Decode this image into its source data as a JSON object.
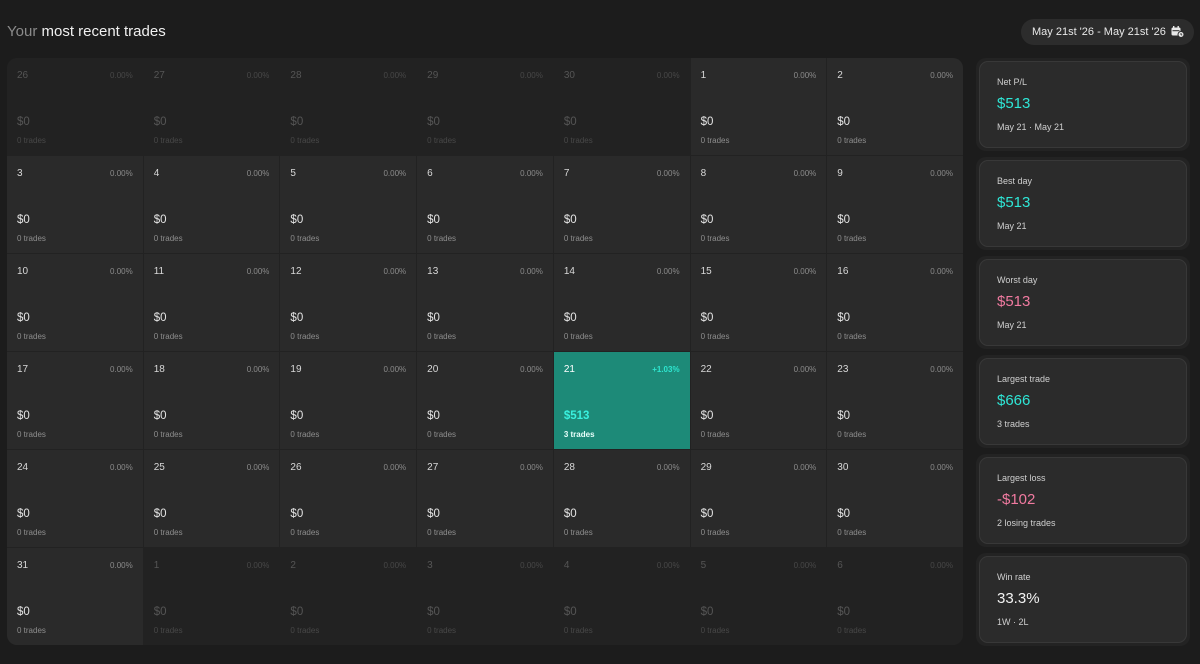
{
  "header": {
    "title_muted": "Your ",
    "title_strong": "most recent trades",
    "date_range": "May 21st '26 - May 21st '26",
    "date_icon": "calendar-icon"
  },
  "calendar": {
    "cells": [
      {
        "day": "26",
        "pct": "0.00%",
        "amount": "$0",
        "trades": "0 trades",
        "state": "out"
      },
      {
        "day": "27",
        "pct": "0.00%",
        "amount": "$0",
        "trades": "0 trades",
        "state": "out"
      },
      {
        "day": "28",
        "pct": "0.00%",
        "amount": "$0",
        "trades": "0 trades",
        "state": "out"
      },
      {
        "day": "29",
        "pct": "0.00%",
        "amount": "$0",
        "trades": "0 trades",
        "state": "out"
      },
      {
        "day": "30",
        "pct": "0.00%",
        "amount": "$0",
        "trades": "0 trades",
        "state": "out"
      },
      {
        "day": "1",
        "pct": "0.00%",
        "amount": "$0",
        "trades": "0 trades",
        "state": "in"
      },
      {
        "day": "2",
        "pct": "0.00%",
        "amount": "$0",
        "trades": "0 trades",
        "state": "in"
      },
      {
        "day": "3",
        "pct": "0.00%",
        "amount": "$0",
        "trades": "0 trades",
        "state": "in"
      },
      {
        "day": "4",
        "pct": "0.00%",
        "amount": "$0",
        "trades": "0 trades",
        "state": "in"
      },
      {
        "day": "5",
        "pct": "0.00%",
        "amount": "$0",
        "trades": "0 trades",
        "state": "in"
      },
      {
        "day": "6",
        "pct": "0.00%",
        "amount": "$0",
        "trades": "0 trades",
        "state": "in"
      },
      {
        "day": "7",
        "pct": "0.00%",
        "amount": "$0",
        "trades": "0 trades",
        "state": "in"
      },
      {
        "day": "8",
        "pct": "0.00%",
        "amount": "$0",
        "trades": "0 trades",
        "state": "in"
      },
      {
        "day": "9",
        "pct": "0.00%",
        "amount": "$0",
        "trades": "0 trades",
        "state": "in"
      },
      {
        "day": "10",
        "pct": "0.00%",
        "amount": "$0",
        "trades": "0 trades",
        "state": "in"
      },
      {
        "day": "11",
        "pct": "0.00%",
        "amount": "$0",
        "trades": "0 trades",
        "state": "in"
      },
      {
        "day": "12",
        "pct": "0.00%",
        "amount": "$0",
        "trades": "0 trades",
        "state": "in"
      },
      {
        "day": "13",
        "pct": "0.00%",
        "amount": "$0",
        "trades": "0 trades",
        "state": "in"
      },
      {
        "day": "14",
        "pct": "0.00%",
        "amount": "$0",
        "trades": "0 trades",
        "state": "in"
      },
      {
        "day": "15",
        "pct": "0.00%",
        "amount": "$0",
        "trades": "0 trades",
        "state": "in"
      },
      {
        "day": "16",
        "pct": "0.00%",
        "amount": "$0",
        "trades": "0 trades",
        "state": "in"
      },
      {
        "day": "17",
        "pct": "0.00%",
        "amount": "$0",
        "trades": "0 trades",
        "state": "in"
      },
      {
        "day": "18",
        "pct": "0.00%",
        "amount": "$0",
        "trades": "0 trades",
        "state": "in"
      },
      {
        "day": "19",
        "pct": "0.00%",
        "amount": "$0",
        "trades": "0 trades",
        "state": "in"
      },
      {
        "day": "20",
        "pct": "0.00%",
        "amount": "$0",
        "trades": "0 trades",
        "state": "in"
      },
      {
        "day": "21",
        "pct": "+1.03%",
        "amount": "$513",
        "trades": "3 trades",
        "state": "active"
      },
      {
        "day": "22",
        "pct": "0.00%",
        "amount": "$0",
        "trades": "0 trades",
        "state": "in"
      },
      {
        "day": "23",
        "pct": "0.00%",
        "amount": "$0",
        "trades": "0 trades",
        "state": "in"
      },
      {
        "day": "24",
        "pct": "0.00%",
        "amount": "$0",
        "trades": "0 trades",
        "state": "in"
      },
      {
        "day": "25",
        "pct": "0.00%",
        "amount": "$0",
        "trades": "0 trades",
        "state": "in"
      },
      {
        "day": "26",
        "pct": "0.00%",
        "amount": "$0",
        "trades": "0 trades",
        "state": "in"
      },
      {
        "day": "27",
        "pct": "0.00%",
        "amount": "$0",
        "trades": "0 trades",
        "state": "in"
      },
      {
        "day": "28",
        "pct": "0.00%",
        "amount": "$0",
        "trades": "0 trades",
        "state": "in"
      },
      {
        "day": "29",
        "pct": "0.00%",
        "amount": "$0",
        "trades": "0 trades",
        "state": "in"
      },
      {
        "day": "30",
        "pct": "0.00%",
        "amount": "$0",
        "trades": "0 trades",
        "state": "in"
      },
      {
        "day": "31",
        "pct": "0.00%",
        "amount": "$0",
        "trades": "0 trades",
        "state": "in"
      },
      {
        "day": "1",
        "pct": "0.00%",
        "amount": "$0",
        "trades": "0 trades",
        "state": "out"
      },
      {
        "day": "2",
        "pct": "0.00%",
        "amount": "$0",
        "trades": "0 trades",
        "state": "out"
      },
      {
        "day": "3",
        "pct": "0.00%",
        "amount": "$0",
        "trades": "0 trades",
        "state": "out"
      },
      {
        "day": "4",
        "pct": "0.00%",
        "amount": "$0",
        "trades": "0 trades",
        "state": "out"
      },
      {
        "day": "5",
        "pct": "0.00%",
        "amount": "$0",
        "trades": "0 trades",
        "state": "out"
      },
      {
        "day": "6",
        "pct": "0.00%",
        "amount": "$0",
        "trades": "0 trades",
        "state": "out"
      }
    ]
  },
  "stats": [
    {
      "name": "net-pl",
      "label": "Net P/L",
      "value": "$513",
      "sub": "May 21 · May 21",
      "color": "#2ee6d6"
    },
    {
      "name": "best-day",
      "label": "Best day",
      "value": "$513",
      "sub": "May 21",
      "color": "#2ee6d6"
    },
    {
      "name": "worst-day",
      "label": "Worst day",
      "value": "$513",
      "sub": "May 21",
      "color": "#f07aa0"
    },
    {
      "name": "largest-trade",
      "label": "Largest trade",
      "value": "$666",
      "sub": "3 trades",
      "color": "#2ee6d6"
    },
    {
      "name": "largest-loss",
      "label": "Largest loss",
      "value": "-$102",
      "sub": "2 losing trades",
      "color": "#f07aa0"
    },
    {
      "name": "win-rate",
      "label": "Win rate",
      "value": "33.3%",
      "sub": "1W · 2L",
      "color": "#f2f2f2"
    }
  ]
}
